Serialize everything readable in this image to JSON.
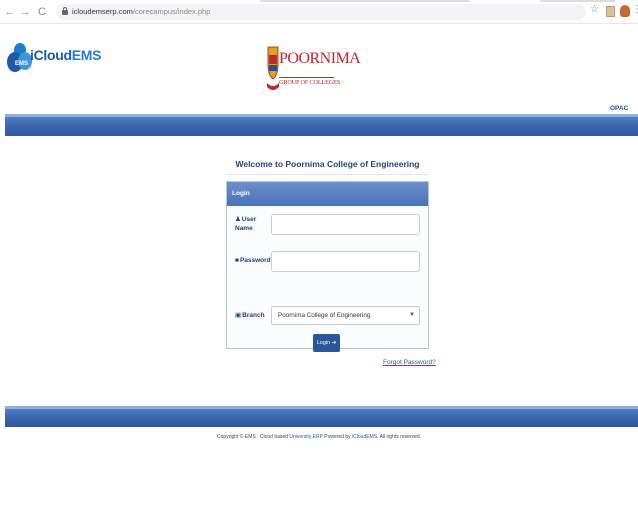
{
  "browser": {
    "url_host": "icloudemserp.com",
    "url_path": "/corecampus/index.php",
    "back": "←",
    "forward": "→",
    "reload": "C",
    "star": "☆",
    "menu": "⋮"
  },
  "header": {
    "ems_brand_prefix": "iCloud",
    "ems_brand_suffix": "EMS",
    "ems_badge": "EMS",
    "college_logo_name": "POORNIMA",
    "college_logo_sub": "GROUP OF COLLEGES",
    "opac_link": "OPAC"
  },
  "main": {
    "welcome": "Welcome to Poornima College of Engineering",
    "login_panel": {
      "title": "Login",
      "username_label": "User Name",
      "password_label": "Password",
      "branch_label": "Branch",
      "branch_value": "Poornima College of Engineering",
      "login_button": "Login ➔"
    },
    "forgot_password": "Forgot Password?"
  },
  "footer": {
    "copyright_prefix": "Copyright © EMS : Cloud based ",
    "erp_link": "University ERP",
    "powered_by": " Powered by ",
    "ems_link": "iCloudEMS",
    "rights": ". All rights reserved."
  },
  "colors": {
    "brand_blue": "#2b559c",
    "bar_blue": "#3a66b0",
    "college_red": "#c2272d"
  }
}
